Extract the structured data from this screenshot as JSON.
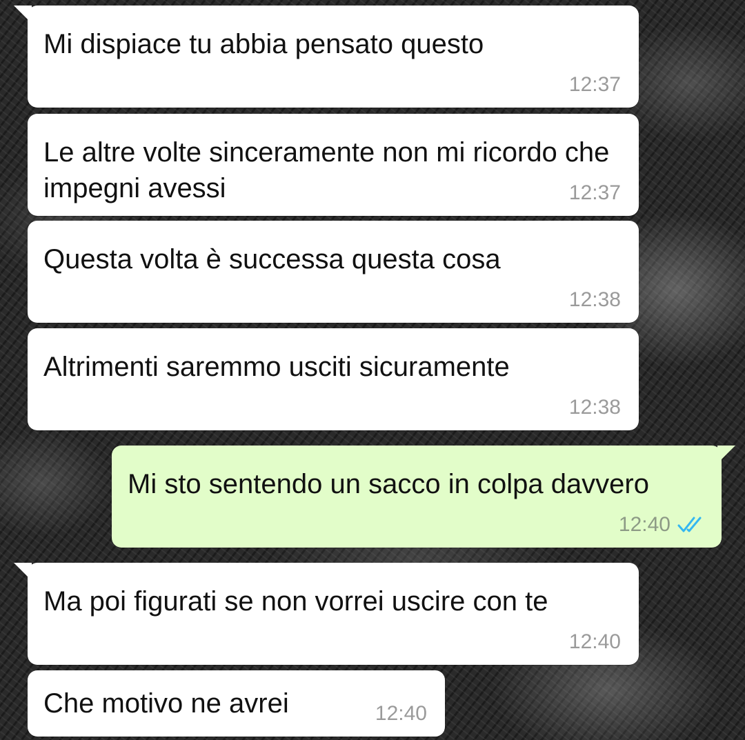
{
  "messages": [
    {
      "direction": "incoming",
      "text": "Mi dispiace tu abbia pensato questo",
      "time": "12:37"
    },
    {
      "direction": "incoming",
      "text": "Le altre volte sinceramente non mi ricordo che impegni avessi",
      "time": "12:37"
    },
    {
      "direction": "incoming",
      "text": "Questa volta è successa questa cosa",
      "time": "12:38"
    },
    {
      "direction": "incoming",
      "text": "Altrimenti saremmo usciti sicuramente",
      "time": "12:38"
    },
    {
      "direction": "outgoing",
      "text": "Mi sto sentendo un sacco in colpa davvero",
      "time": "12:40",
      "status": "read",
      "status_icon": "double-check-icon"
    },
    {
      "direction": "incoming",
      "text": "Ma poi figurati se non vorrei uscire con te",
      "time": "12:40"
    },
    {
      "direction": "incoming",
      "text": "Che motivo ne avrei",
      "time": "12:40"
    }
  ],
  "colors": {
    "incoming_bubble": "#ffffff",
    "outgoing_bubble": "#e2fdc9",
    "read_ticks": "#34b7f1",
    "timestamp": "#9a9a9a"
  }
}
